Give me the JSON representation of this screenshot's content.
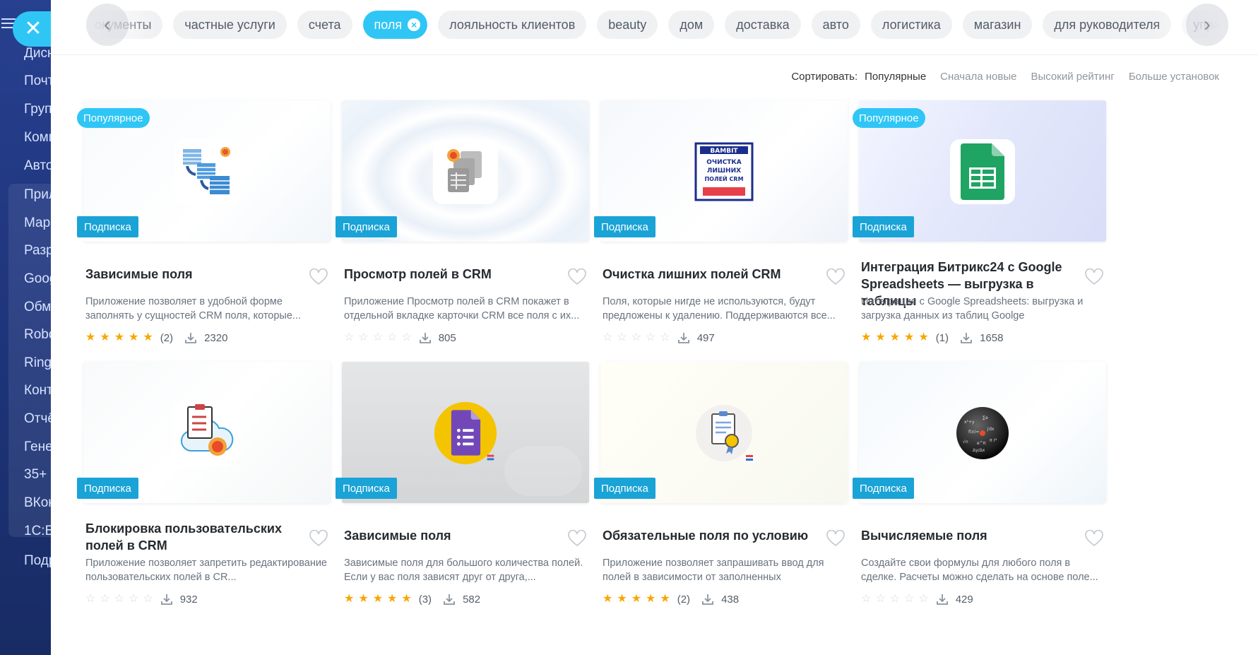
{
  "sidebar": {
    "items": [
      "Дисн",
      "Почт",
      "Груп",
      "Комп",
      "Авто",
      "Прил",
      "Мар",
      "Разр",
      "Goog",
      "Обм",
      "Robo",
      "Ring",
      "Конт",
      "Отчё",
      "Гене",
      "35+",
      "ВКон",
      "1С:Б",
      "Подр"
    ]
  },
  "tags": {
    "items": [
      "окументы",
      "частные услуги",
      "счета",
      "поля",
      "лояльность клиентов",
      "beauty",
      "дом",
      "доставка",
      "авто",
      "логистика",
      "магазин",
      "для руководителя",
      "управление оче"
    ],
    "active_index": 3
  },
  "sort": {
    "label": "Сортировать:",
    "options": [
      "Популярные",
      "Сначала новые",
      "Высокий рейтинг",
      "Больше установок"
    ],
    "selected_index": 0
  },
  "badges": {
    "popular": "Популярное",
    "subscription": "Подписка"
  },
  "cards": [
    {
      "title": "Зависимые поля",
      "desc": "Приложение позволяет в удобной форме заполнять у сущностей CRM поля, которые...",
      "stars": 5,
      "reviews": "(2)",
      "installs": "2320",
      "popular": true,
      "icon": "dependent-fields-icon"
    },
    {
      "title": "Просмотр полей в CRM",
      "desc": "Приложение Просмотр полей в CRM покажет в отдельной вкладке карточки CRM все поля с их...",
      "stars": 0,
      "reviews": "",
      "installs": "805",
      "popular": false,
      "icon": "view-fields-icon"
    },
    {
      "title": "Очистка лишних полей CRM",
      "desc": "Поля, которые нигде не используются, будут предложены к удалению. Поддерживаются все...",
      "stars": 0,
      "reviews": "",
      "installs": "497",
      "popular": false,
      "icon": "bambit-cleanup-icon",
      "icon_text": [
        "BAMBIT",
        "ОЧИСТКА",
        "ЛИШНИХ",
        "ПОЛЕЙ CRM"
      ]
    },
    {
      "title": "Интеграция Битрикс24 с Google Spreadsheets — выгрузка в таблицы",
      "desc": "Интеграция с Google Spreadsheets: выгрузка и загрузка данных из таблиц Goolge",
      "stars": 5,
      "reviews": "(1)",
      "installs": "1658",
      "popular": true,
      "icon": "google-sheets-icon"
    },
    {
      "title": "Блокировка пользовательских полей в CRM",
      "desc": "Приложение позволяет запретить редактирование пользовательских полей в CR...",
      "stars": 0,
      "reviews": "",
      "installs": "932",
      "popular": false,
      "icon": "field-lock-icon"
    },
    {
      "title": "Зависимые поля",
      "desc": "Зависимые поля для большого количества полей. Если у вас поля зависят друг от друга,...",
      "stars": 5,
      "reviews": "(3)",
      "installs": "582",
      "popular": false,
      "icon": "google-forms-icon"
    },
    {
      "title": "Обязательные поля по условию",
      "desc": "Приложение позволяет запрашивать ввод для полей в зависимости от заполненных",
      "stars": 5,
      "reviews": "(2)",
      "installs": "438",
      "popular": false,
      "icon": "certificate-icon"
    },
    {
      "title": "Вычисляемые поля",
      "desc": "Создайте свои формулы для любого поля в сделке. Расчеты можно сделать на основе поле...",
      "stars": 0,
      "reviews": "",
      "installs": "429",
      "popular": false,
      "icon": "formula-sphere-icon"
    }
  ],
  "colors": {
    "accent": "#2fc6f6",
    "subscription_badge": "#1aa3d6",
    "star": "#f7a700",
    "sidebar": "#27408f"
  }
}
